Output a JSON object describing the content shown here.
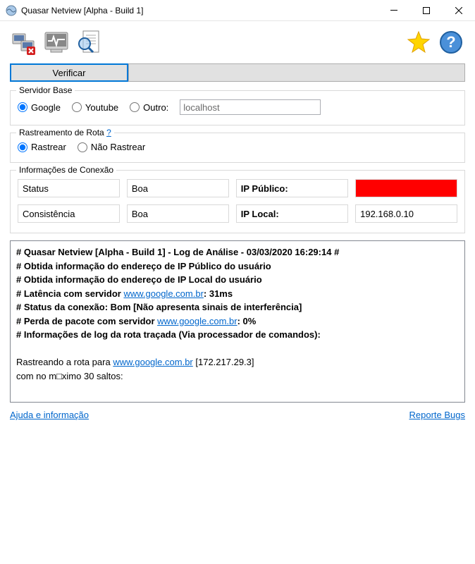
{
  "window": {
    "title": "Quasar Netview [Alpha - Build 1]"
  },
  "buttons": {
    "verify": "Verificar"
  },
  "fieldset_server": {
    "legend": "Servidor Base",
    "google": "Google",
    "youtube": "Youtube",
    "other": "Outro:",
    "other_value": "localhost"
  },
  "fieldset_trace": {
    "legend": "Rastreamento de Rota",
    "help": "?",
    "trace": "Rastrear",
    "notrace": "Não Rastrear"
  },
  "fieldset_conn": {
    "legend": "Informações de Conexão",
    "status_label": "Status",
    "status_value": "Boa",
    "pubip_label": "IP Público:",
    "consistency_label": "Consistência",
    "consistency_value": "Boa",
    "locip_label": "IP Local:",
    "locip_value": "192.168.0.10"
  },
  "log": {
    "l1a": "# Quasar Netview [Alpha - Build 1] - Log de Análise - 03/03/2020 16:29:14 #",
    "l2": "# Obtida informação do endereço de IP Público do usuário",
    "l3": "# Obtida informação do endereço de IP Local do usuário",
    "l4a": "# Latência com servidor ",
    "l4b": "www.google.com.br",
    "l4c": ": 31ms",
    "l5": "# Status da conexão: Bom [Não apresenta sinais de interferência]",
    "l6a": "# Perda de pacote com servidor ",
    "l6b": "www.google.com.br",
    "l6c": ": 0%",
    "l7": "# Informações de log da rota traçada (Via processador de comandos):",
    "l8a": "Rastreando a rota para ",
    "l8b": "www.google.com.br",
    "l8c": " [172.217.29.3]",
    "l9": "com no m□ximo 30 saltos:"
  },
  "footer": {
    "help": "Ajuda e informação",
    "bugs": "Reporte Bugs"
  }
}
